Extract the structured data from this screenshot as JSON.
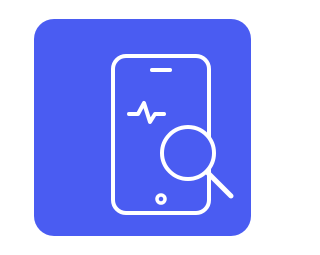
{
  "icon": {
    "name": "phone-health-search-icon",
    "background_color": "#4a5cf2",
    "stroke_color": "#ffffff"
  }
}
